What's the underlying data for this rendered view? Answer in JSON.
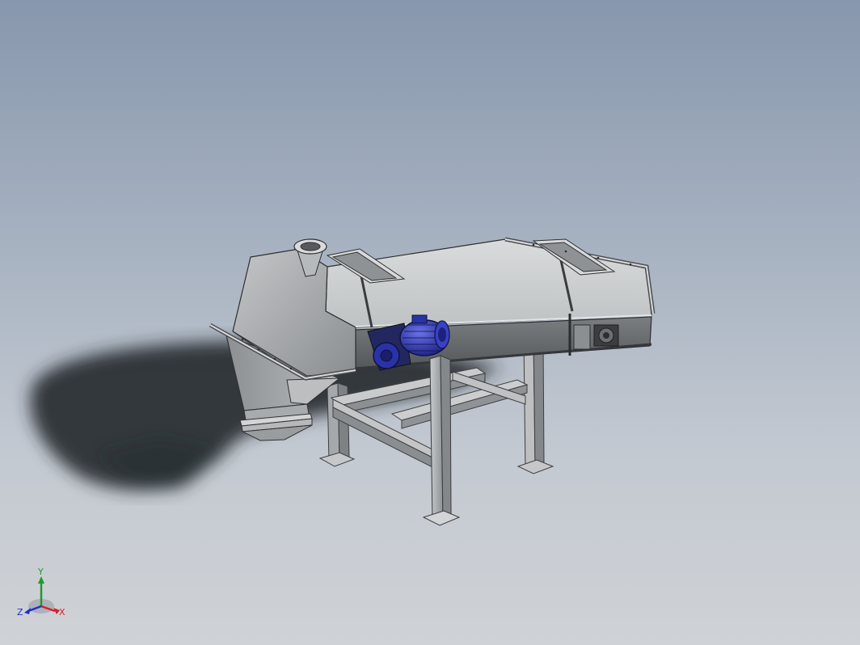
{
  "viewport": {
    "background_top": "#8797ad",
    "background_bottom": "#cfd2d6"
  },
  "model": {
    "body_color": "#a9acae",
    "motor_color": "#2b34b0",
    "frame_color": "#b8bbbd"
  },
  "triad": {
    "x_label": "X",
    "y_label": "Y",
    "z_label": "Z",
    "x_color": "#d4202a",
    "y_color": "#1f9a2c",
    "z_color": "#1f2fc4"
  }
}
